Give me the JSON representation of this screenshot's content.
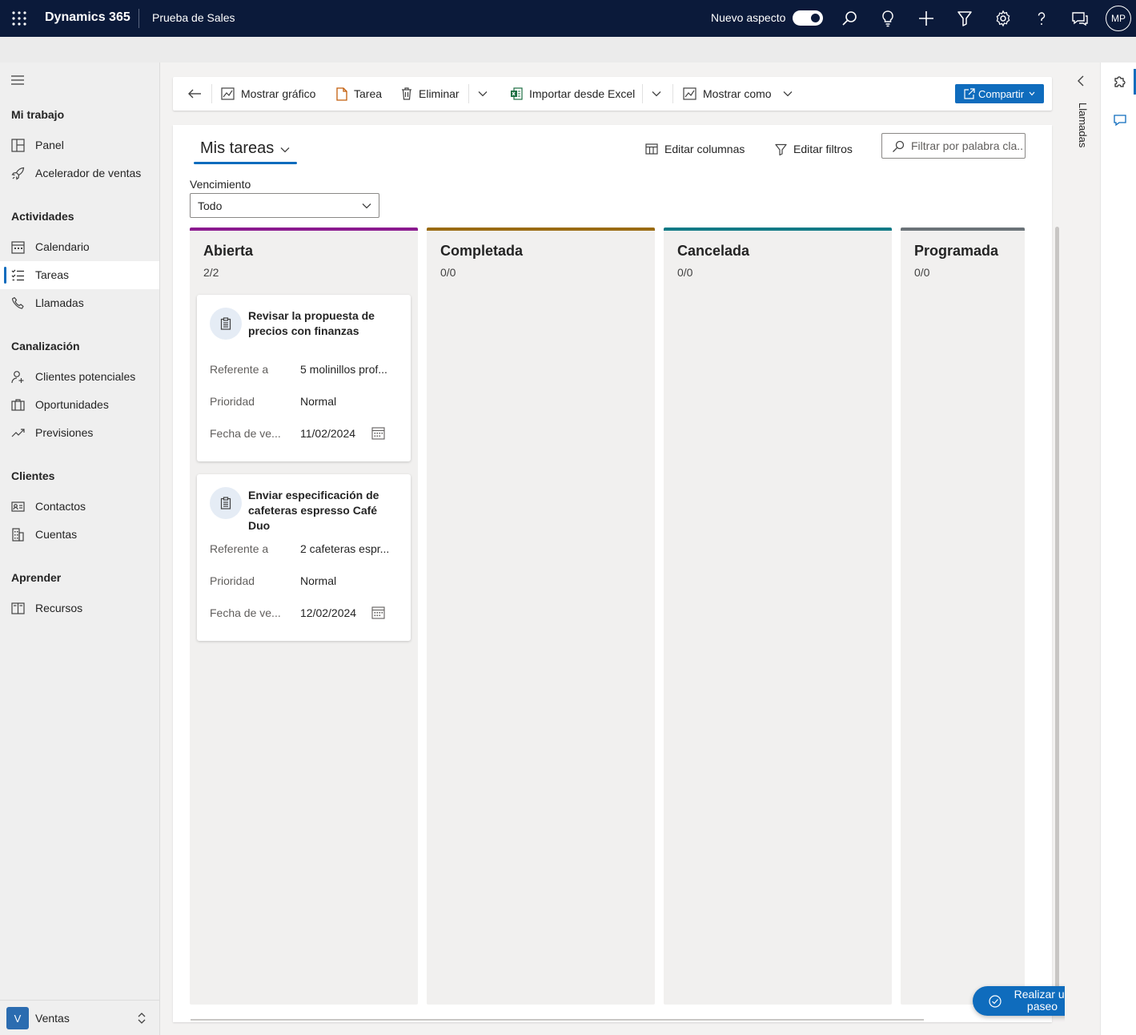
{
  "topbar": {
    "brand": "Dynamics 365",
    "app_name": "Prueba de Sales",
    "new_look_label": "Nuevo aspecto",
    "new_look_on": true,
    "avatar_initials": "MP"
  },
  "nav": {
    "groups": {
      "my_work": "Mi trabajo",
      "activities": "Actividades",
      "pipeline": "Canalización",
      "customers": "Clientes",
      "learn": "Aprender"
    },
    "items": {
      "panel": "Panel",
      "accelerator": "Acelerador de ventas",
      "calendar": "Calendario",
      "tasks": "Tareas",
      "calls": "Llamadas",
      "leads": "Clientes potenciales",
      "opportunities": "Oportunidades",
      "forecasts": "Previsiones",
      "contacts": "Contactos",
      "accounts": "Cuentas",
      "resources": "Recursos"
    },
    "active_item": "Tareas",
    "area": {
      "badge": "V",
      "label": "Ventas"
    }
  },
  "commandbar": {
    "show_chart": "Mostrar gráfico",
    "task": "Tarea",
    "delete": "Eliminar",
    "import_excel": "Importar desde Excel",
    "show_as": "Mostrar como",
    "share": "Compartir"
  },
  "view": {
    "title": "Mis tareas",
    "edit_columns": "Editar columnas",
    "edit_filters": "Editar filtros",
    "search_placeholder": "Filtrar por palabra cla...",
    "filter_label": "Vencimiento",
    "filter_value": "Todo"
  },
  "board": {
    "lanes": [
      {
        "title": "Abierta",
        "count": "2/2",
        "color": "#8b1a8f"
      },
      {
        "title": "Completada",
        "count": "0/0",
        "color": "#9a6b12"
      },
      {
        "title": "Cancelada",
        "count": "0/0",
        "color": "#127a86"
      },
      {
        "title": "Programada",
        "count": "0/0",
        "color": "#6b7378"
      }
    ],
    "cards": [
      {
        "title": "Revisar la propuesta de precios con finanzas",
        "regarding_label": "Referente a",
        "regarding_value": "5 molinillos prof...",
        "priority_label": "Prioridad",
        "priority_value": "Normal",
        "due_label": "Fecha de ve...",
        "due_value": "11/02/2024"
      },
      {
        "title": "Enviar especificación de cafeteras espresso Café Duo",
        "regarding_label": "Referente a",
        "regarding_value": "2 cafeteras espr...",
        "priority_label": "Prioridad",
        "priority_value": "Normal",
        "due_label": "Fecha de ve...",
        "due_value": "12/02/2024"
      }
    ]
  },
  "tour_button": "Realizar un paseo",
  "side_pane_label": "Llamadas",
  "colors": {
    "topbar": "#0b1a3a",
    "accent": "#0f6cbd"
  }
}
